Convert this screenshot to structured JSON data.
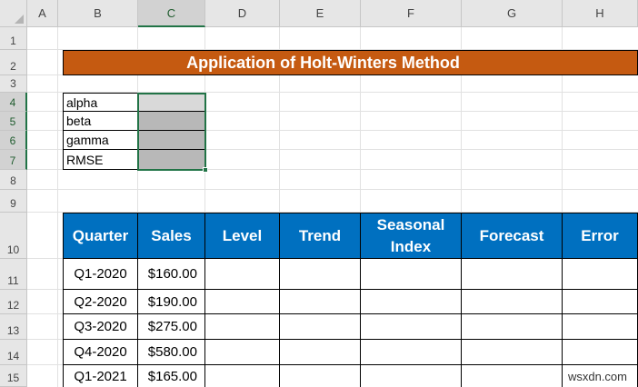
{
  "columns": [
    "A",
    "B",
    "C",
    "D",
    "E",
    "F",
    "G",
    "H"
  ],
  "rows": [
    "1",
    "2",
    "3",
    "4",
    "5",
    "6",
    "7",
    "8",
    "9",
    "10",
    "11",
    "12",
    "13",
    "14",
    "15"
  ],
  "title": "Application of Holt-Winters Method",
  "parameters": [
    {
      "label": "alpha",
      "value": ""
    },
    {
      "label": "beta",
      "value": ""
    },
    {
      "label": "gamma",
      "value": ""
    },
    {
      "label": "RMSE",
      "value": ""
    }
  ],
  "table": {
    "headers": [
      "Quarter",
      "Sales",
      "Level",
      "Trend",
      "Seasonal Index",
      "Forecast",
      "Error"
    ],
    "rows": [
      {
        "quarter": "Q1-2020",
        "sales": "$160.00"
      },
      {
        "quarter": "Q2-2020",
        "sales": "$190.00"
      },
      {
        "quarter": "Q3-2020",
        "sales": "$275.00"
      },
      {
        "quarter": "Q4-2020",
        "sales": "$580.00"
      },
      {
        "quarter": "Q1-2021",
        "sales": "$165.00"
      }
    ]
  },
  "selection": {
    "column": "C",
    "rows": "4:7"
  },
  "colors": {
    "banner": "#c55a11",
    "header": "#0070c0",
    "selection": "#217346"
  },
  "watermark": "wsxdn.com"
}
